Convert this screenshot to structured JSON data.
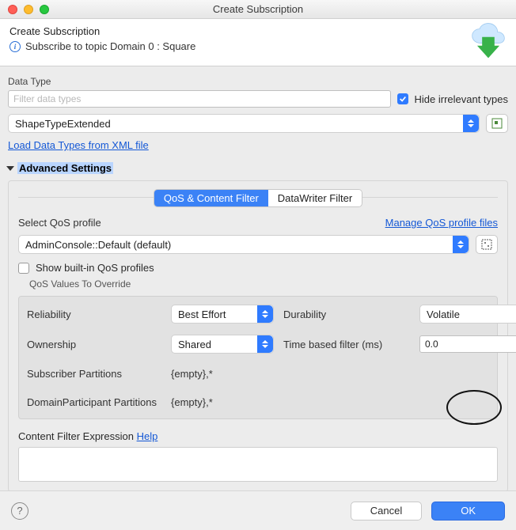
{
  "window": {
    "title": "Create Subscription"
  },
  "header": {
    "title": "Create Subscription",
    "subtitle": "Subscribe to topic Domain 0 : Square"
  },
  "data_type": {
    "section_label": "Data Type",
    "filter_placeholder": "Filter data types",
    "hide_irrelevant_label": "Hide irrelevant types",
    "hide_irrelevant_checked": true,
    "selected": "ShapeTypeExtended",
    "load_link": "Load Data Types from XML file"
  },
  "advanced": {
    "label": "Advanced Settings",
    "tabs": {
      "qos": "QoS & Content Filter",
      "dw": "DataWriter Filter"
    },
    "qos": {
      "select_label": "Select QoS profile",
      "manage_link": "Manage QoS profile files",
      "profile": "AdminConsole::Default (default)",
      "show_builtin_label": "Show built-in QoS profiles",
      "show_builtin_checked": false,
      "override_label": "QoS Values To Override",
      "reliability": {
        "label": "Reliability",
        "value": "Best Effort"
      },
      "durability": {
        "label": "Durability",
        "value": "Volatile"
      },
      "ownership": {
        "label": "Ownership",
        "value": "Shared"
      },
      "time_filter": {
        "label": "Time based filter (ms)",
        "value": "0.0"
      },
      "sub_partitions": {
        "label": "Subscriber Partitions",
        "value": "{empty},*"
      },
      "dp_partitions": {
        "label": "DomainParticipant Partitions",
        "value": "{empty},*"
      }
    },
    "content_filter": {
      "label": "Content Filter Expression",
      "help": "Help"
    }
  },
  "footer": {
    "cancel": "Cancel",
    "ok": "OK"
  }
}
